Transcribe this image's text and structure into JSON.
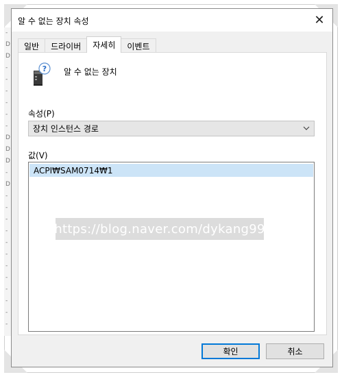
{
  "window": {
    "title": "알 수 없는 장치 속성",
    "close_glyph": "✕"
  },
  "tabs": [
    {
      "label": "일반",
      "active": false
    },
    {
      "label": "드라이버",
      "active": false
    },
    {
      "label": "자세히",
      "active": true
    },
    {
      "label": "이벤트",
      "active": false
    }
  ],
  "device": {
    "name": "알 수 없는 장치",
    "icon": "unknown-device-icon"
  },
  "property": {
    "label": "속성(P)",
    "selected": "장치 인스턴스 경로"
  },
  "value": {
    "label": "값(V)",
    "items": [
      "ACPI₩SAM0714₩1"
    ]
  },
  "watermark": {
    "text": "https://blog.naver.com/dykang99"
  },
  "buttons": {
    "ok": "확인",
    "cancel": "취소"
  },
  "background_letters": [
    "-",
    "D",
    "D",
    "-",
    "-",
    "-",
    "-",
    "-",
    "-",
    "D",
    "D",
    "D",
    "-",
    "D",
    "-",
    "-",
    "-",
    "-",
    "-",
    "-",
    "-",
    "-",
    "-",
    "-",
    "-",
    "-"
  ],
  "colors": {
    "selection": "#cce4f7",
    "focus_border": "#0078d7"
  }
}
